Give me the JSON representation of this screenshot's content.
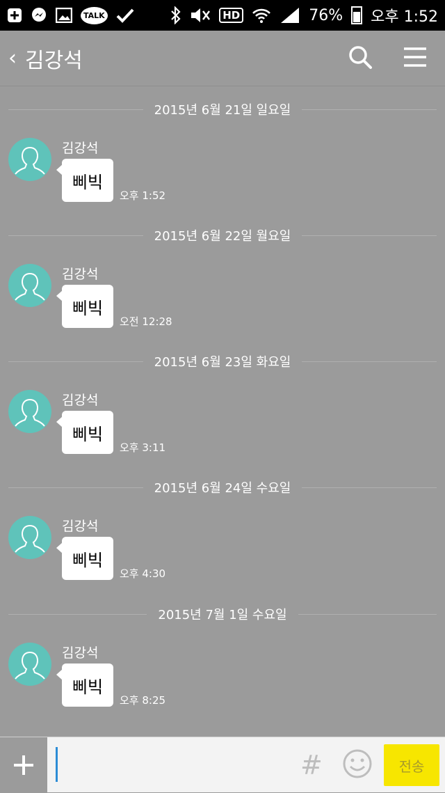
{
  "status_bar": {
    "battery": "76%",
    "time": "오후 1:52",
    "hd_label": "HD",
    "talk_label": "TALK"
  },
  "header": {
    "title": "김강석"
  },
  "messages": [
    {
      "date": "2015년 6월 21일 일요일",
      "sender": "김강석",
      "text": "삐빅",
      "time": "오후 1:52"
    },
    {
      "date": "2015년 6월 22일 월요일",
      "sender": "김강석",
      "text": "삐빅",
      "time": "오전 12:28"
    },
    {
      "date": "2015년 6월 23일 화요일",
      "sender": "김강석",
      "text": "삐빅",
      "time": "오후 3:11"
    },
    {
      "date": "2015년 6월 24일 수요일",
      "sender": "김강석",
      "text": "삐빅",
      "time": "오후 4:30"
    },
    {
      "date": "2015년 7월 1일 수요일",
      "sender": "김강석",
      "text": "삐빅",
      "time": "오후 8:25"
    }
  ],
  "input": {
    "value": "",
    "send_label": "전송",
    "hash_label": "#"
  },
  "colors": {
    "background": "#9b9b9b",
    "avatar": "#5fc3ba",
    "send": "#f7e600"
  }
}
